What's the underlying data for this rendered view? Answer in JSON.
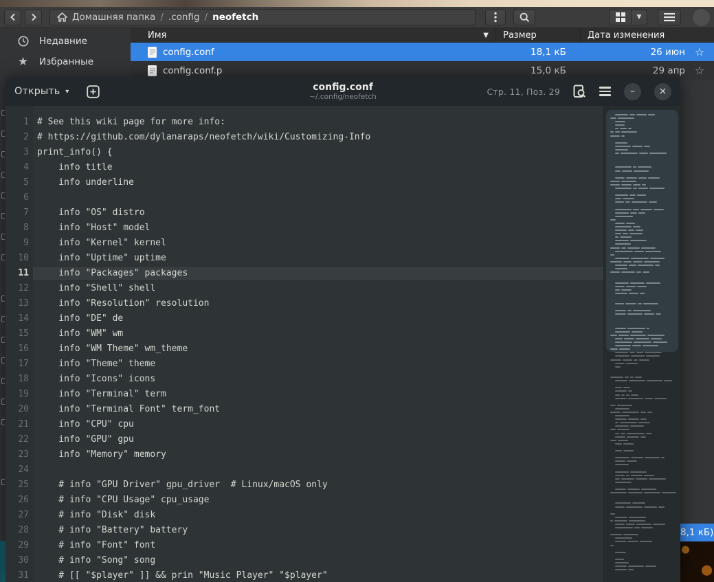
{
  "file_manager": {
    "toolbar": {
      "back_icon": "‹",
      "forward_icon": "›",
      "breadcrumb": {
        "crumbs": [
          {
            "label": "Домашняя папка",
            "icon": "home",
            "current": false
          },
          {
            "label": ".config",
            "icon": null,
            "current": false
          },
          {
            "label": "neofetch",
            "icon": null,
            "current": true
          }
        ]
      },
      "menu_dots_icon": "⋮",
      "search_icon": "magnifier",
      "view_grid_icon": "grid",
      "view_dropdown_icon": "▼",
      "app_menu_icon": "hamburger"
    },
    "columns": {
      "name": "Имя",
      "sort_icon": "▼",
      "size": "Размер",
      "modified": "Дата изменения"
    },
    "sidebar": {
      "items": [
        {
          "label": "Недавние",
          "icon": "clock"
        },
        {
          "label": "Избранные",
          "icon": "star"
        }
      ]
    },
    "files": [
      {
        "name": "config.conf",
        "size": "18,1 кБ",
        "modified": "26 июн",
        "selected": true,
        "star": "☆"
      },
      {
        "name": "config.conf.p",
        "size": "15,0 кБ",
        "modified": "29 апр",
        "selected": false,
        "star": "☆"
      }
    ],
    "status_fragment": "8,1 кБ)"
  },
  "editor": {
    "open_label": "Открыть",
    "open_caret": "▾",
    "new_tab_icon": "plus-square",
    "title": "config.conf",
    "subtitle": "~/.config/neofetch",
    "cursor_position": "Стр. 11, Поз. 29",
    "search_doc_icon": "document-magnifier",
    "menu_icon": "hamburger",
    "minimize_icon": "–",
    "close_icon": "×",
    "current_line": 11,
    "lines": [
      "# See this wiki page for more info:",
      "# https://github.com/dylanaraps/neofetch/wiki/Customizing-Info",
      "print_info() {",
      "    info title",
      "    info underline",
      "",
      "    info \"OS\" distro",
      "    info \"Host\" model",
      "    info \"Kernel\" kernel",
      "    info \"Uptime\" uptime",
      "    info \"Packages\" packages",
      "    info \"Shell\" shell",
      "    info \"Resolution\" resolution",
      "    info \"DE\" de",
      "    info \"WM\" wm",
      "    info \"WM Theme\" wm_theme",
      "    info \"Theme\" theme",
      "    info \"Icons\" icons",
      "    info \"Terminal\" term",
      "    info \"Terminal Font\" term_font",
      "    info \"CPU\" cpu",
      "    info \"GPU\" gpu",
      "    info \"Memory\" memory",
      "",
      "    # info \"GPU Driver\" gpu_driver  # Linux/macOS only",
      "    # info \"CPU Usage\" cpu_usage",
      "    # info \"Disk\" disk",
      "    # info \"Battery\" battery",
      "    # info \"Font\" font",
      "    # info \"Song\" song",
      "    # [[ \"$player\" ]] && prin \"Music Player\" \"$player\""
    ]
  },
  "colors": {
    "accent_selection": "#3584e4",
    "editor_background": "#2e3436",
    "editor_foreground": "#d3d7cf",
    "toolbar_background": "#3c3c3d"
  }
}
